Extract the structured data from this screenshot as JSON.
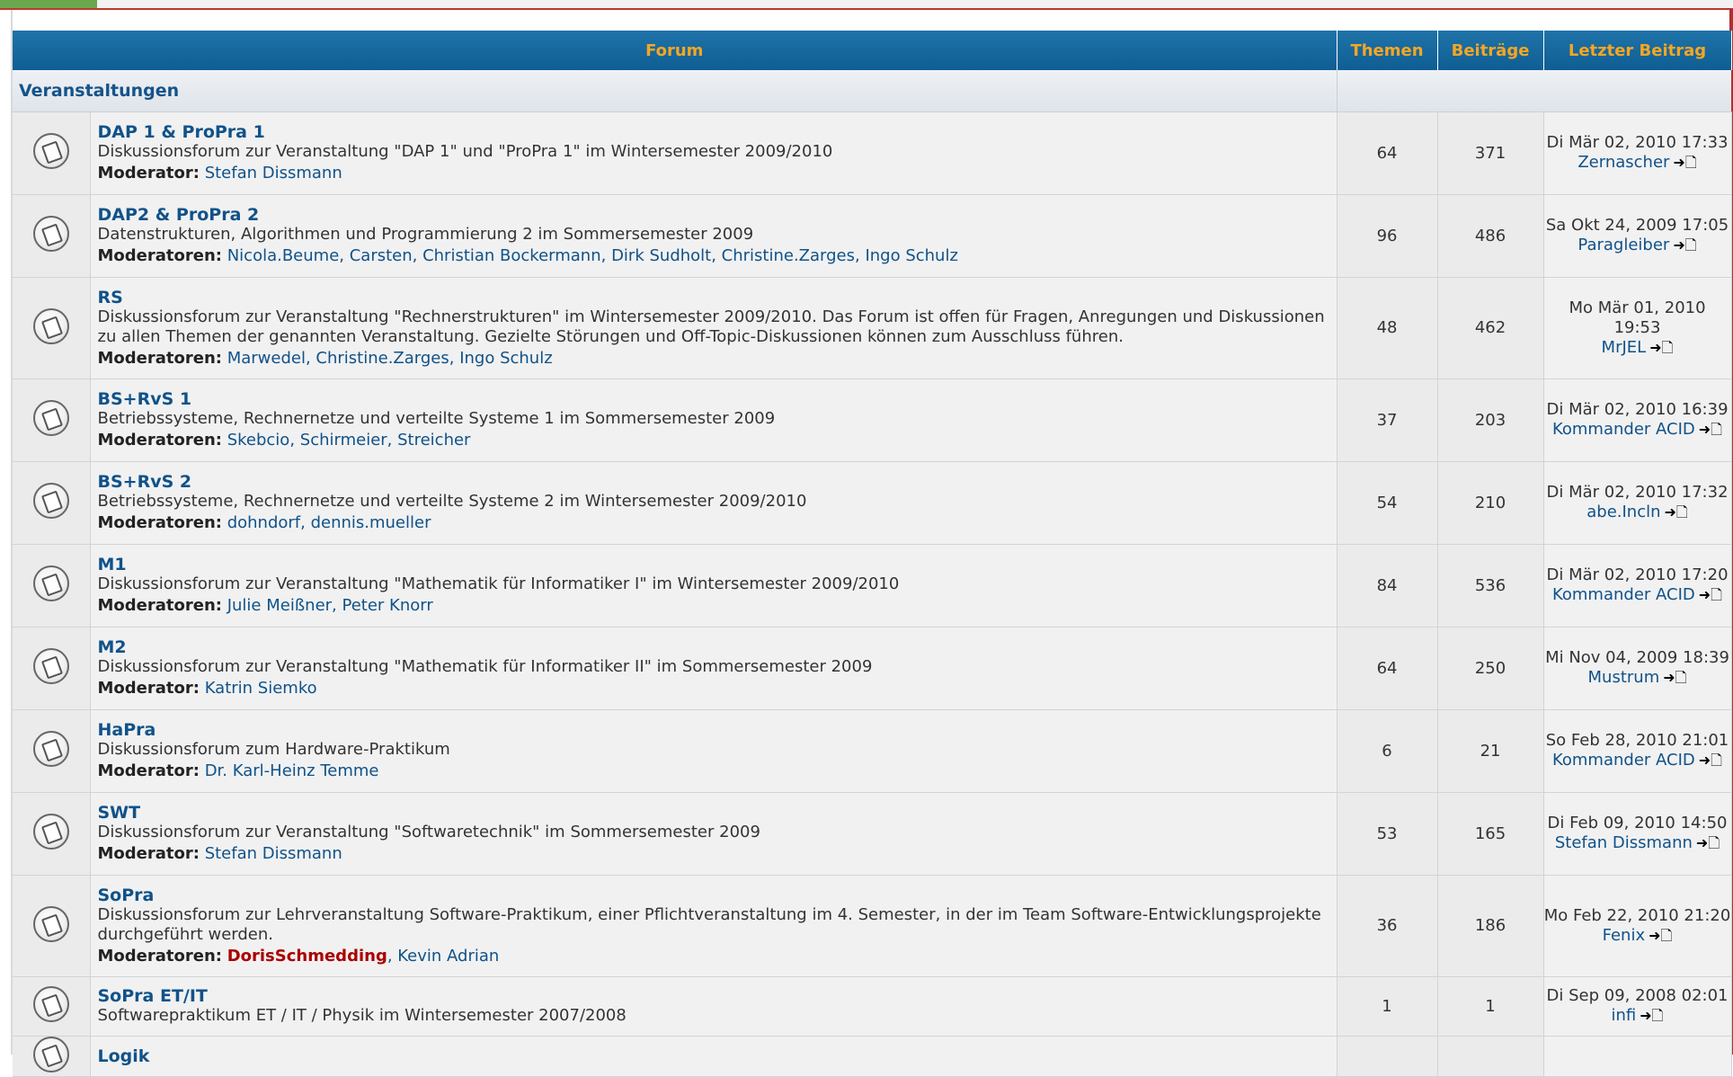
{
  "header": {
    "forum": "Forum",
    "topics": "Themen",
    "posts": "Beiträge",
    "last": "Letzter Beitrag"
  },
  "category": {
    "name": "Veranstaltungen"
  },
  "arrow_glyph": "➜🗋",
  "forums": [
    {
      "name": "DAP 1 & ProPra 1",
      "desc": "Diskussionsforum zur Veranstaltung \"DAP 1\" und \"ProPra 1\" im Wintersemester 2009/2010",
      "mod_label": "Moderator:",
      "mods": "Stefan Dissmann",
      "topics": "64",
      "posts": "371",
      "last_date": "Di Mär 02, 2010 17:33",
      "last_user": "Zernascher"
    },
    {
      "name": "DAP2 & ProPra 2",
      "desc": "Datenstrukturen, Algorithmen und Programmierung 2 im Sommersemester 2009",
      "mod_label": "Moderatoren:",
      "mods": "Nicola.Beume, Carsten, Christian Bockermann, Dirk Sudholt, Christine.Zarges, Ingo Schulz",
      "topics": "96",
      "posts": "486",
      "last_date": "Sa Okt 24, 2009 17:05",
      "last_user": "Paragleiber"
    },
    {
      "name": "RS",
      "desc": "Diskussionsforum zur Veranstaltung \"Rechnerstrukturen\" im Wintersemester 2009/2010. Das Forum ist offen für Fragen, Anregungen und Diskussionen zu allen Themen der genannten Veranstaltung. Gezielte Störungen und Off-Topic-Diskussionen können zum Ausschluss führen.",
      "mod_label": "Moderatoren:",
      "mods": "Marwedel, Christine.Zarges, Ingo Schulz",
      "topics": "48",
      "posts": "462",
      "last_date": "Mo Mär 01, 2010 19:53",
      "last_user": "MrJEL"
    },
    {
      "name": "BS+RvS 1",
      "desc": "Betriebssysteme, Rechnernetze und verteilte Systeme 1 im Sommersemester 2009",
      "mod_label": "Moderatoren:",
      "mods": "Skebcio, Schirmeier, Streicher",
      "topics": "37",
      "posts": "203",
      "last_date": "Di Mär 02, 2010 16:39",
      "last_user": "Kommander ACID"
    },
    {
      "name": "BS+RvS 2",
      "desc": "Betriebssysteme, Rechnernetze und verteilte Systeme 2 im Wintersemester 2009/2010",
      "mod_label": "Moderatoren:",
      "mods": "dohndorf, dennis.mueller",
      "topics": "54",
      "posts": "210",
      "last_date": "Di Mär 02, 2010 17:32",
      "last_user": "abe.Incln"
    },
    {
      "name": "M1",
      "desc": "Diskussionsforum zur Veranstaltung \"Mathematik für Informatiker I\" im Wintersemester 2009/2010",
      "mod_label": "Moderatoren:",
      "mods": "Julie Meißner, Peter Knorr",
      "topics": "84",
      "posts": "536",
      "last_date": "Di Mär 02, 2010 17:20",
      "last_user": "Kommander ACID"
    },
    {
      "name": "M2",
      "desc": "Diskussionsforum zur Veranstaltung \"Mathematik für Informatiker II\" im Sommersemester 2009",
      "mod_label": "Moderator:",
      "mods": "Katrin Siemko",
      "topics": "64",
      "posts": "250",
      "last_date": "Mi Nov 04, 2009 18:39",
      "last_user": "Mustrum"
    },
    {
      "name": "HaPra",
      "desc": "Diskussionsforum zum Hardware-Praktikum",
      "mod_label": "Moderator:",
      "mods": "Dr. Karl-Heinz Temme",
      "topics": "6",
      "posts": "21",
      "last_date": "So Feb 28, 2010 21:01",
      "last_user": "Kommander ACID"
    },
    {
      "name": "SWT",
      "desc": "Diskussionsforum zur Veranstaltung \"Softwaretechnik\" im Sommersemester 2009",
      "mod_label": "Moderator:",
      "mods": "Stefan Dissmann",
      "topics": "53",
      "posts": "165",
      "last_date": "Di Feb 09, 2010 14:50",
      "last_user": "Stefan Dissmann"
    },
    {
      "name": "SoPra",
      "desc": "Diskussionsforum zur Lehrveranstaltung Software-Praktikum, einer Pflichtveranstaltung im 4. Semester, in der im Team Software-Entwicklungsprojekte durchgeführt werden.",
      "mod_label": "Moderatoren:",
      "mods_red": "DorisSchmedding",
      "mods": ", Kevin Adrian",
      "topics": "36",
      "posts": "186",
      "last_date": "Mo Feb 22, 2010 21:20",
      "last_user": "Fenix"
    },
    {
      "name": "SoPra ET/IT",
      "desc": "Softwarepraktikum ET / IT / Physik im Wintersemester 2007/2008",
      "topics": "1",
      "posts": "1",
      "last_date": "Di Sep 09, 2008 02:01",
      "last_user": "infi"
    },
    {
      "name": "Logik"
    }
  ]
}
